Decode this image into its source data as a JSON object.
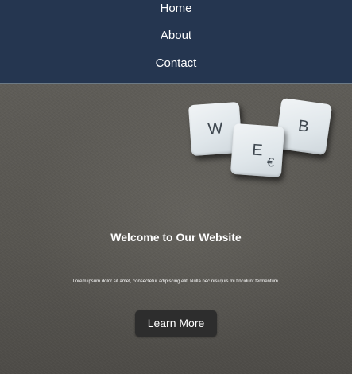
{
  "nav": {
    "items": [
      {
        "label": "Home"
      },
      {
        "label": "About"
      },
      {
        "label": "Contact"
      }
    ]
  },
  "hero": {
    "tiles": [
      {
        "letter": "W"
      },
      {
        "letter": "E",
        "symbol": "€"
      },
      {
        "letter": "B"
      }
    ],
    "title": "Welcome to Our Website",
    "text": "Lorem ipsum dolor sit amet, consectetur adipiscing elit. Nulla nec nisi quis mi tincidunt fermentum.",
    "button_label": "Learn More"
  },
  "colors": {
    "nav_background": "#253650",
    "button_background": "#2d2d2d",
    "text": "#ffffff"
  }
}
